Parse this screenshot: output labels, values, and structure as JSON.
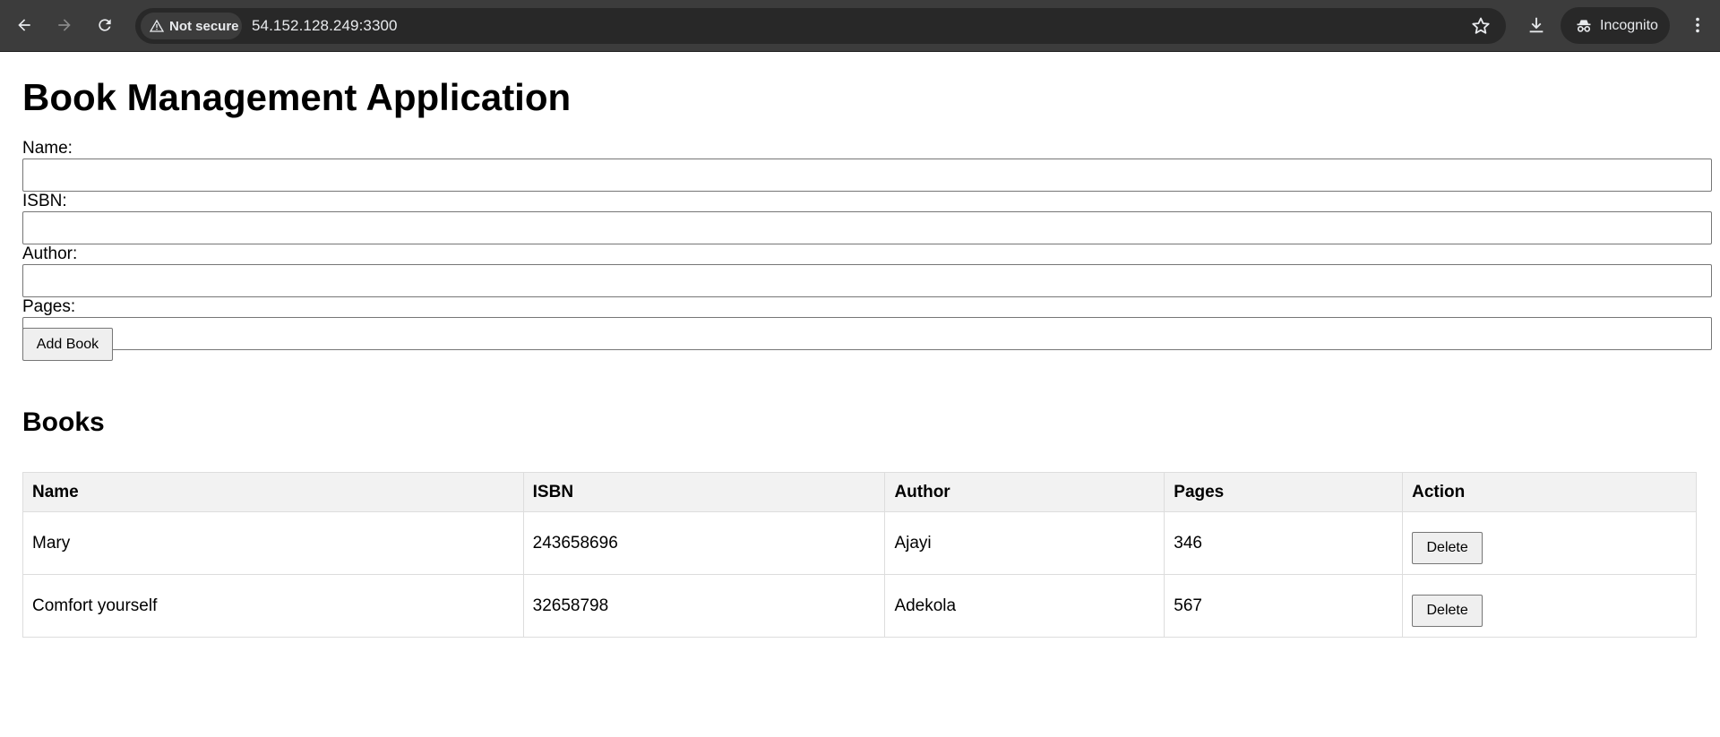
{
  "browser": {
    "security_label": "Not secure",
    "url": "54.152.128.249:3300",
    "profile_label": "Incognito"
  },
  "page": {
    "title": "Book Management Application",
    "form": {
      "fields": [
        {
          "label": "Name:",
          "value": ""
        },
        {
          "label": "ISBN:",
          "value": ""
        },
        {
          "label": "Author:",
          "value": ""
        },
        {
          "label": "Pages:",
          "value": ""
        }
      ],
      "submit_label": "Add Book"
    },
    "books_heading": "Books",
    "table": {
      "headers": [
        "Name",
        "ISBN",
        "Author",
        "Pages",
        "Action"
      ],
      "rows": [
        {
          "name": "Mary",
          "isbn": "243658696",
          "author": "Ajayi",
          "pages": "346",
          "action": "Delete"
        },
        {
          "name": "Comfort yourself",
          "isbn": "32658798",
          "author": "Adekola",
          "pages": "567",
          "action": "Delete"
        }
      ]
    }
  }
}
